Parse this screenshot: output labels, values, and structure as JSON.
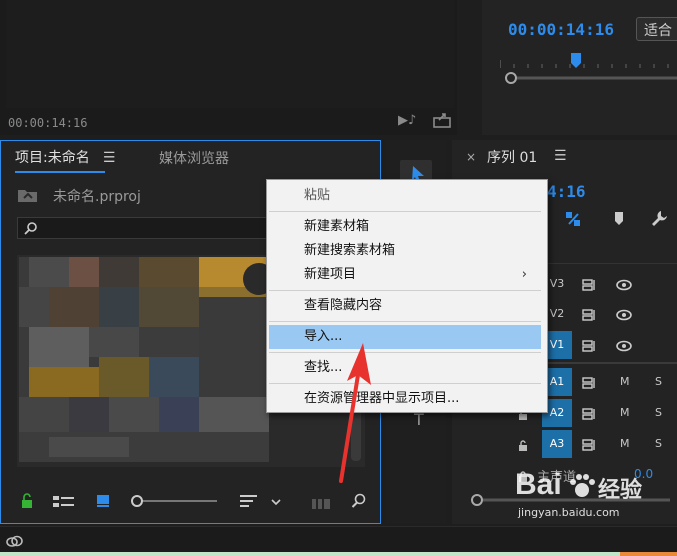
{
  "source_monitor": {
    "timecode": "00:00:14:16"
  },
  "program_monitor": {
    "timecode": "00:00:14:16",
    "fit_label": "适合"
  },
  "project_panel": {
    "tab_project": "项目:未命名",
    "tab_media_browser": "媒体浏览器",
    "filename": "未命名.prproj"
  },
  "timeline": {
    "tab_label": "序列 01",
    "timecode_partial": "4:16",
    "tracks": [
      {
        "label": "V3"
      },
      {
        "label": "V2"
      },
      {
        "label": "V1"
      },
      {
        "label": "A1"
      },
      {
        "label": "A2"
      },
      {
        "label": "A3"
      }
    ],
    "audio_m": "M",
    "audio_s": "S",
    "master_label": "主声道",
    "master_value": "0.0"
  },
  "context_menu": {
    "items": [
      {
        "label": "粘贴",
        "state": "disabled"
      },
      {
        "label": "新建素材箱",
        "state": "normal"
      },
      {
        "label": "新建搜索素材箱",
        "state": "normal"
      },
      {
        "label": "新建项目",
        "state": "normal",
        "submenu": true
      },
      {
        "label": "查看隐藏内容",
        "state": "normal"
      },
      {
        "label": "导入...",
        "state": "highlighted"
      },
      {
        "label": "查找...",
        "state": "normal"
      },
      {
        "label": "在资源管理器中显示项目...",
        "state": "normal"
      }
    ]
  },
  "watermark": {
    "brand": "Bai",
    "brand2": "经验",
    "url": "jingyan.baidu.com"
  },
  "colors": {
    "accent_blue": "#2d8ceb",
    "menu_highlight": "#99c9f2",
    "track_target": "#1d6fa8",
    "lock_green": "#35b335"
  }
}
